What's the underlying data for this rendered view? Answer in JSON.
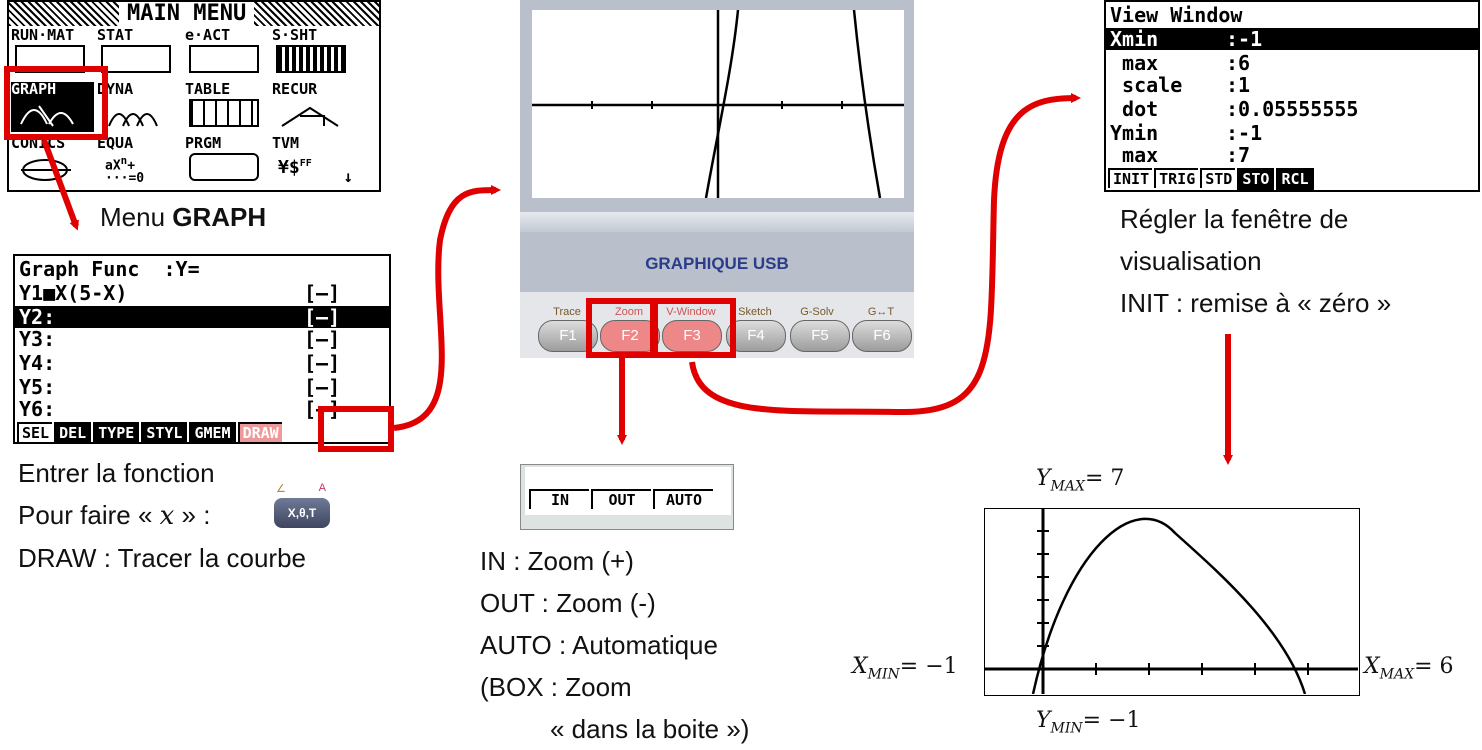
{
  "main_menu": {
    "title": "MAIN MENU",
    "items": [
      "RUN·MAT",
      "STAT",
      "e·ACT",
      "S·SHT",
      "GRAPH",
      "DYNA",
      "TABLE",
      "RECUR",
      "CONICS",
      "EQUA",
      "PRGM",
      "TVM"
    ]
  },
  "menu_caption": {
    "prefix": "Menu ",
    "bold": "GRAPH"
  },
  "graph_func": {
    "header": "Graph Func  :Y=",
    "rows": [
      "Y1■X(5-X)",
      "Y2:",
      "Y3:",
      "Y4:",
      "Y5:",
      "Y6:"
    ],
    "marker": "[—]",
    "softkeys": [
      "SEL",
      "DEL",
      "TYPE",
      "STYL",
      "GMEM",
      "DRAW"
    ]
  },
  "left_caption": {
    "line1": "Entrer la fonction",
    "line2_prefix": "Pour faire « ",
    "line2_var": "x",
    "line2_suffix": " » :",
    "line3": "DRAW : Tracer la courbe",
    "key_label": "X,θ,T",
    "key_top_left": "∠",
    "key_top_right": "A"
  },
  "calculator": {
    "brand": "GRAPHIQUE USB",
    "fkeys": [
      {
        "key": "F1",
        "label": "Trace"
      },
      {
        "key": "F2",
        "label": "Zoom"
      },
      {
        "key": "F3",
        "label": "V-Window"
      },
      {
        "key": "F4",
        "label": "Sketch"
      },
      {
        "key": "F5",
        "label": "G-Solv"
      },
      {
        "key": "F6",
        "label": "G↔T"
      }
    ]
  },
  "zoom_menu": {
    "softkeys": [
      "IN",
      "OUT",
      "AUTO"
    ]
  },
  "zoom_caption": {
    "line1": "IN : Zoom (+)",
    "line2": "OUT : Zoom (-)",
    "line3": "AUTO : Automatique",
    "line4": "(BOX : Zoom",
    "line5": "« dans la boite »)"
  },
  "view_window": {
    "title": "View Window",
    "rows": [
      {
        "label": "Xmin",
        "value": ":-1",
        "selected": true
      },
      {
        "label": " max",
        "value": ":6",
        "selected": false
      },
      {
        "label": " scale",
        "value": ":1",
        "selected": false
      },
      {
        "label": " dot",
        "value": ":0.05555555",
        "selected": false
      },
      {
        "label": "Ymin",
        "value": ":-1",
        "selected": false
      },
      {
        "label": " max",
        "value": ":7",
        "selected": false
      }
    ],
    "softkeys": [
      "INIT",
      "TRIG",
      "STD",
      "STO",
      "RCL"
    ]
  },
  "right_caption": {
    "line1": "Régler la fenêtre de",
    "line2": "visualisation",
    "line3": "INIT : remise à « zéro »"
  },
  "result_graph": {
    "ymax": {
      "var": "Y",
      "sub": "MAX",
      "value": "= 7"
    },
    "ymin": {
      "var": "Y",
      "sub": "MIN",
      "value": "= −1"
    },
    "xmin": {
      "var": "X",
      "sub": "MIN",
      "value": "= −1"
    },
    "xmax": {
      "var": "X",
      "sub": "MAX",
      "value": "= 6"
    }
  },
  "colors": {
    "accent": "#e00000",
    "lcd_bg": "#ffffff"
  }
}
